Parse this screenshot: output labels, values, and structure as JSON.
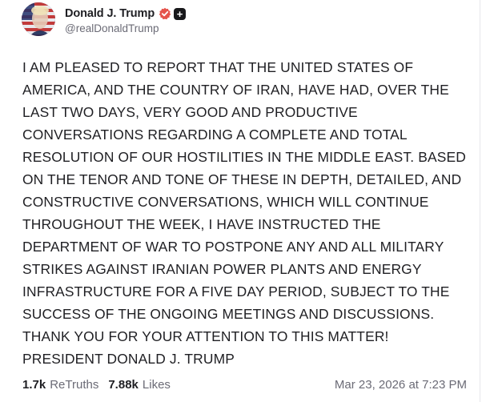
{
  "author": {
    "display_name": "Donald J. Trump",
    "handle": "@realDonaldTrump",
    "verified_icon": "verified-badge-icon",
    "extra_badge_icon": "plus-square-icon",
    "verified_color": "#e5534b"
  },
  "post": {
    "text": "I AM PLEASED TO REPORT THAT THE UNITED STATES OF\nAMERICA, AND THE COUNTRY OF IRAN, HAVE HAD, OVER THE\nLAST TWO DAYS, VERY GOOD AND PRODUCTIVE\nCONVERSATIONS REGARDING A COMPLETE AND TOTAL\nRESOLUTION OF OUR HOSTILITIES IN THE MIDDLE EAST. BASED\nON THE TENOR AND TONE OF THESE IN DEPTH, DETAILED, AND\nCONSTRUCTIVE CONVERSATIONS, WHICH WILL CONTINUE\nTHROUGHOUT THE WEEK, I HAVE INSTRUCTED THE\nDEPARTMENT OF WAR TO POSTPONE ANY AND ALL MILITARY\nSTRIKES AGAINST IRANIAN POWER PLANTS AND ENERGY\nINFRASTRUCTURE FOR A FIVE DAY PERIOD, SUBJECT TO THE\nSUCCESS OF THE ONGOING MEETINGS AND DISCUSSIONS.\nTHANK YOU FOR YOUR ATTENTION TO THIS MATTER!\nPRESIDENT DONALD J. TRUMP"
  },
  "stats": {
    "retruths_count": "1.7k",
    "retruths_label": "ReTruths",
    "likes_count": "7.88k",
    "likes_label": "Likes"
  },
  "timestamp": "Mar 23, 2026 at 7:23 PM"
}
